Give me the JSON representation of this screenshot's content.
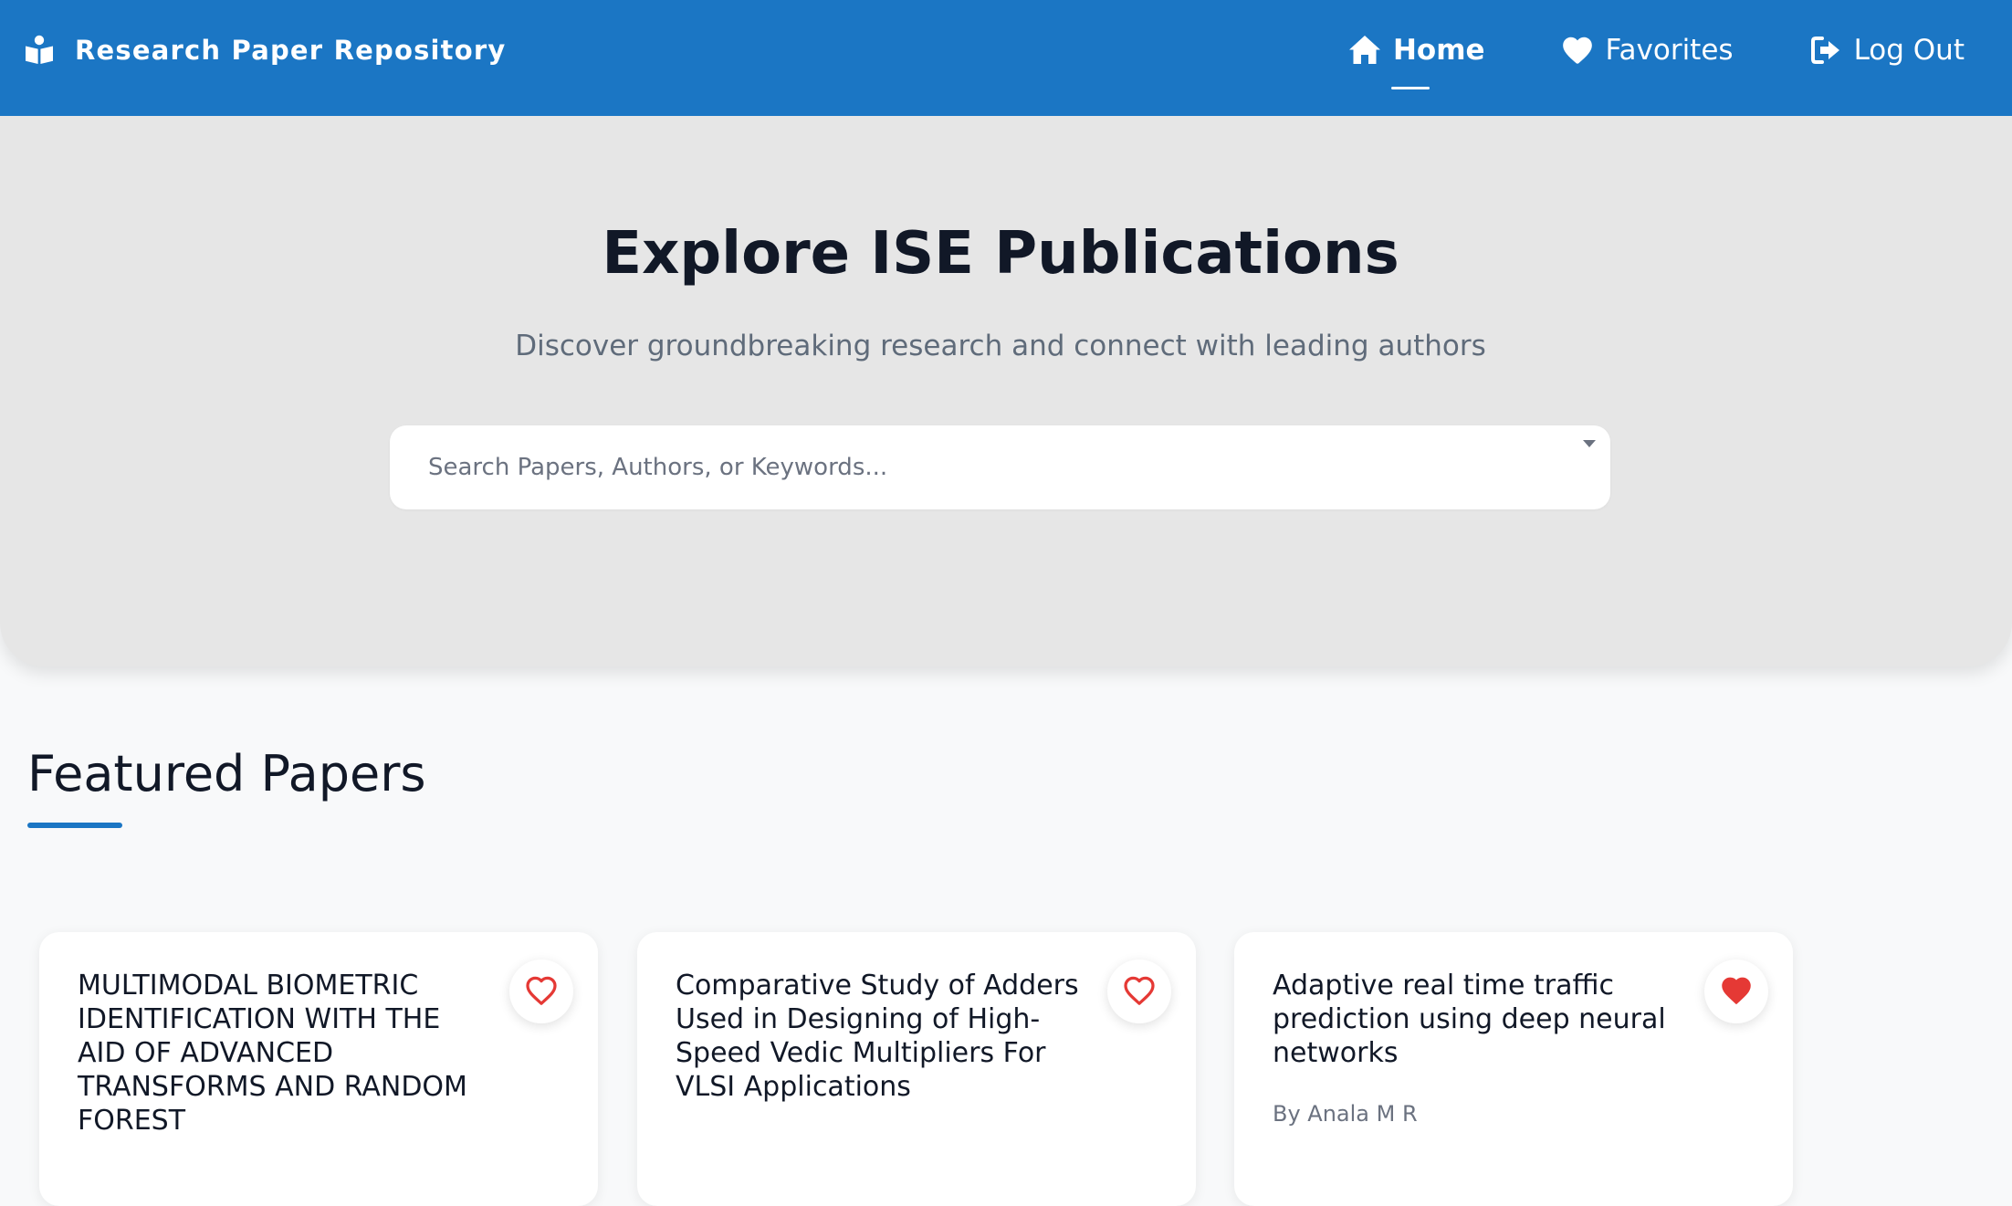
{
  "header": {
    "brand": {
      "icon": "book-reader-icon",
      "label": "Research Paper Repository"
    },
    "nav": [
      {
        "label": "Home",
        "icon": "home-icon",
        "active": true
      },
      {
        "label": "Favorites",
        "icon": "heart-icon",
        "active": false
      },
      {
        "label": "Log Out",
        "icon": "sign-out-icon",
        "active": false
      }
    ]
  },
  "hero": {
    "title": "Explore ISE Publications",
    "subtitle": "Discover groundbreaking research and connect with leading authors",
    "search": {
      "placeholder": "Search Papers, Authors, or Keywords...",
      "value": ""
    }
  },
  "featured": {
    "title": "Featured Papers",
    "papers": [
      {
        "title": "MULTIMODAL BIOMETRIC IDENTIFICATION WITH THE AID OF ADVANCED TRANSFORMS AND RANDOM FOREST",
        "authors": "",
        "favorited": false
      },
      {
        "title": "Comparative Study of Adders Used in Designing of High-Speed Vedic Multipliers For VLSI Applications",
        "authors": "",
        "favorited": false
      },
      {
        "title": "Adaptive real time traffic prediction using deep neural networks",
        "authors": "By Anala M R",
        "favorited": true
      }
    ]
  },
  "colors": {
    "primary": "#1b76c4",
    "hero_bg": "#e6e6e6",
    "page_bg": "#f8f9fa",
    "heading": "#111827",
    "muted": "#6b7280",
    "favorite_active": "#e53935"
  }
}
